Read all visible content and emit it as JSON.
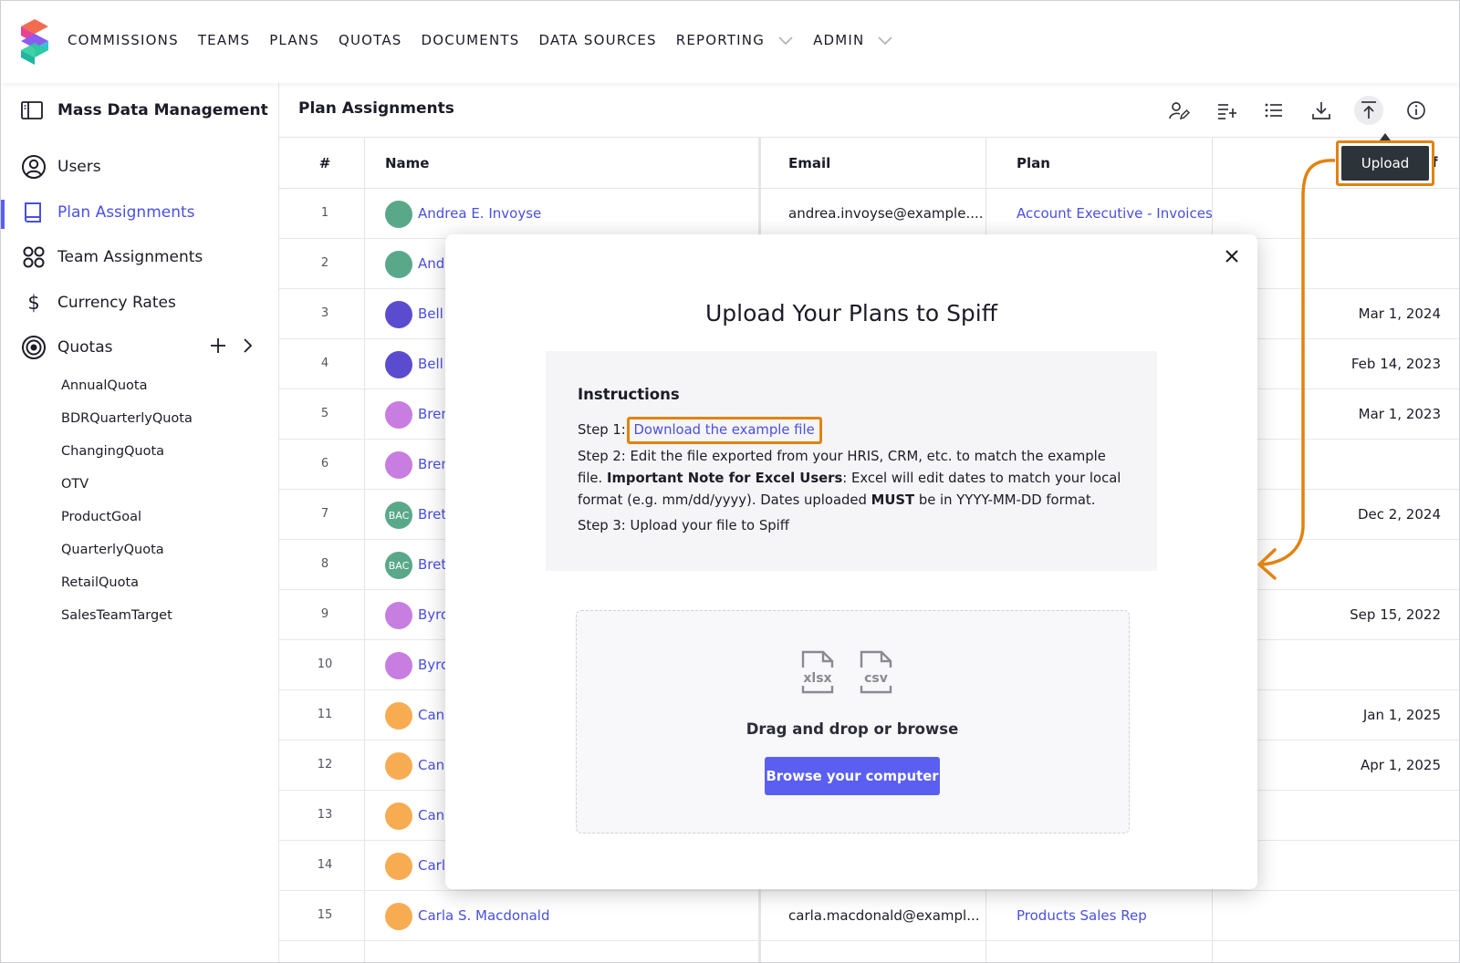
{
  "nav": {
    "items": [
      "COMMISSIONS",
      "TEAMS",
      "PLANS",
      "QUOTAS",
      "DOCUMENTS",
      "DATA SOURCES",
      "REPORTING",
      "ADMIN"
    ]
  },
  "sidebar": {
    "title": "Mass Data Management",
    "items": [
      {
        "label": "Users",
        "icon": "user-circle-icon"
      },
      {
        "label": "Plan Assignments",
        "icon": "book-icon"
      },
      {
        "label": "Team Assignments",
        "icon": "grid-circles-icon"
      },
      {
        "label": "Currency Rates",
        "icon": "dollar-icon"
      },
      {
        "label": "Quotas",
        "icon": "target-icon"
      }
    ],
    "quotas": [
      "AnnualQuota",
      "BDRQuarterlyQuota",
      "ChangingQuota",
      "OTV",
      "ProductGoal",
      "QuarterlyQuota",
      "RetailQuota",
      "SalesTeamTarget"
    ]
  },
  "content": {
    "title": "Plan Assignments",
    "columns": {
      "num": "#",
      "name": "Name",
      "email": "Email",
      "plan": "Plan",
      "trail": "f"
    },
    "tooltip": "Upload",
    "rows": [
      {
        "num": "1",
        "name": "Andrea E. Invoyse",
        "email": "andrea.invoyse@example....",
        "plan": "Account Executive - Invoices",
        "date": "",
        "avatar": "",
        "color": "#5aa88a"
      },
      {
        "num": "2",
        "name": "And",
        "email": "",
        "plan": "",
        "date": "",
        "avatar": "",
        "color": "#5aa88a"
      },
      {
        "num": "3",
        "name": "Bell",
        "email": "",
        "plan": "",
        "date": "Mar 1, 2024",
        "avatar": "",
        "color": "#5b4ccf"
      },
      {
        "num": "4",
        "name": "Bell",
        "email": "",
        "plan": "",
        "date": "Feb 14, 2023",
        "avatar": "",
        "color": "#5b4ccf"
      },
      {
        "num": "5",
        "name": "Bren",
        "email": "",
        "plan": "",
        "date": "Mar 1, 2023",
        "avatar": "",
        "color": "#c77ee0"
      },
      {
        "num": "6",
        "name": "Bren",
        "email": "",
        "plan": "",
        "date": "",
        "avatar": "",
        "color": "#c77ee0"
      },
      {
        "num": "7",
        "name": "Bret",
        "email": "",
        "plan": "",
        "date": "Dec 2, 2024",
        "avatar": "BAC",
        "color": "#5aa88a"
      },
      {
        "num": "8",
        "name": "Bret",
        "email": "",
        "plan": "",
        "date": "",
        "avatar": "BAC",
        "color": "#5aa88a"
      },
      {
        "num": "9",
        "name": "Byro",
        "email": "",
        "plan": "",
        "date": "Sep 15, 2022",
        "avatar": "",
        "color": "#c77ee0"
      },
      {
        "num": "10",
        "name": "Byro",
        "email": "",
        "plan": "",
        "date": "",
        "avatar": "",
        "color": "#c77ee0"
      },
      {
        "num": "11",
        "name": "Can",
        "email": "",
        "plan": "",
        "date": "Jan 1, 2025",
        "avatar": "",
        "color": "#f7ac52"
      },
      {
        "num": "12",
        "name": "Can",
        "email": "",
        "plan": "",
        "date": "Apr 1, 2025",
        "avatar": "",
        "color": "#f7ac52"
      },
      {
        "num": "13",
        "name": "Can",
        "email": "",
        "plan": "",
        "date": "",
        "avatar": "",
        "color": "#f7ac52"
      },
      {
        "num": "14",
        "name": "Carl",
        "email": "",
        "plan": "",
        "date": "",
        "avatar": "",
        "color": "#f7ac52"
      },
      {
        "num": "15",
        "name": "Carla S. Macdonald",
        "email": "carla.macdonald@exampl...",
        "plan": "Products Sales Rep",
        "date": "",
        "avatar": "",
        "color": "#f7ac52"
      }
    ]
  },
  "modal": {
    "title": "Upload Your Plans to Spiff",
    "instructions_title": "Instructions",
    "step1_prefix": "Step 1:",
    "step1_link": "Download the example file",
    "step2_a": "Step 2: Edit the file exported from your HRIS, CRM, etc. to match the example file.",
    "step2_b": "Important Note for Excel Users",
    "step2_c": ": Excel will edit dates to match your local format (e.g. mm/dd/yyyy). Dates uploaded",
    "step2_d": "MUST",
    "step2_e": "be in YYYY-MM-DD format.",
    "step3": "Step 3: Upload your file to Spiff",
    "xlsx_label": "xlsx",
    "csv_label": "csv",
    "drop_text": "Drag and drop or browse",
    "browse_button": "Browse your computer"
  },
  "colors": {
    "accent": "#5a5ff2",
    "highlight": "#e08311",
    "tooltip_bg": "#2c3339"
  }
}
